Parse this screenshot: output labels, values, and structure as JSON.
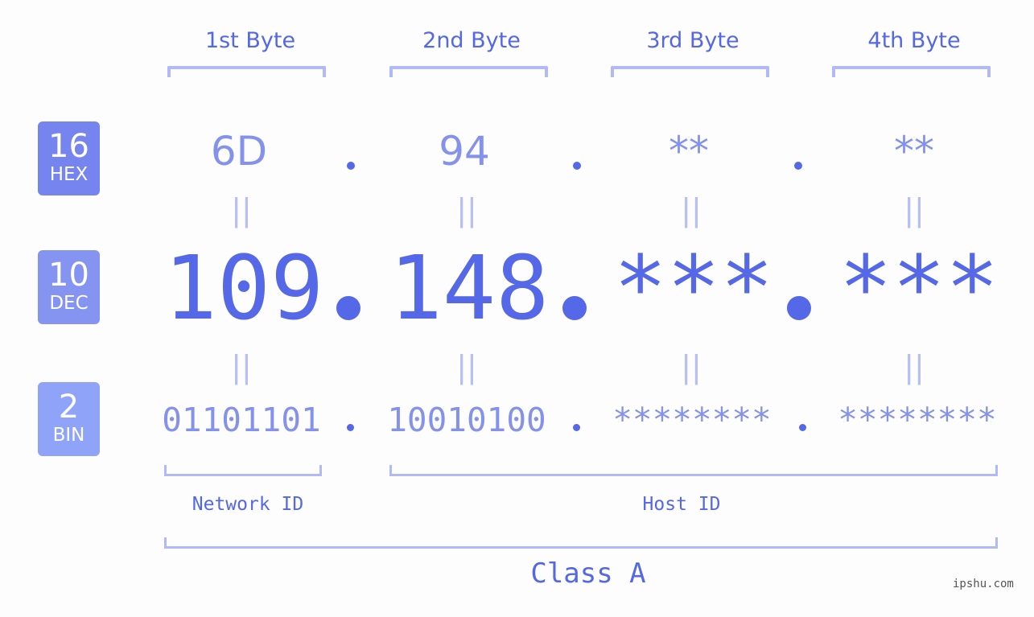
{
  "bytes": [
    {
      "label": "1st Byte",
      "hex": "6D",
      "dec": "109",
      "bin": "01101101"
    },
    {
      "label": "2nd Byte",
      "hex": "94",
      "dec": "148",
      "bin": "10010100"
    },
    {
      "label": "3rd Byte",
      "hex": "**",
      "dec": "***",
      "bin": "********"
    },
    {
      "label": "4th Byte",
      "hex": "**",
      "dec": "***",
      "bin": "********"
    }
  ],
  "badges": {
    "hex": {
      "number": "16",
      "label": "HEX",
      "color": "#7584ee"
    },
    "dec": {
      "number": "10",
      "label": "DEC",
      "color": "#8593f1"
    },
    "bin": {
      "number": "2",
      "label": "BIN",
      "color": "#8fa4f8"
    }
  },
  "equals_sign": "||",
  "network_id_label": "Network ID",
  "host_id_label": "Host ID",
  "class_label": "Class A",
  "watermark": "ipshu.com",
  "colors": {
    "accent": "#5468e8",
    "light": "#8592ec",
    "bracket": "#b1baf7"
  }
}
